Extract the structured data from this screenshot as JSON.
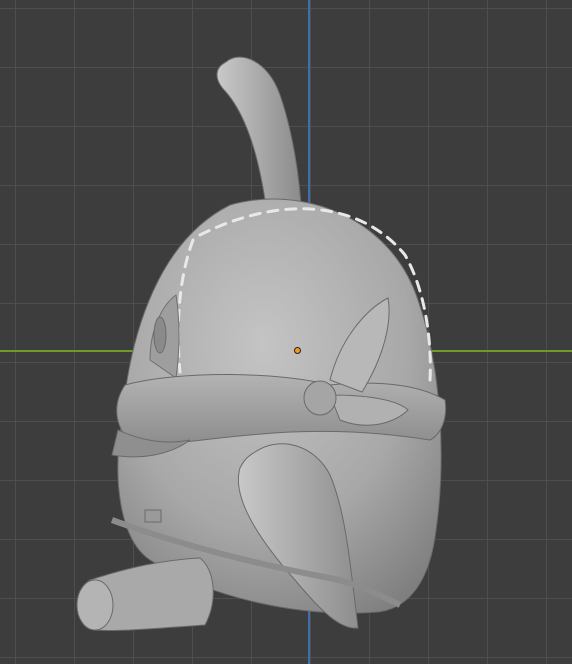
{
  "viewport": {
    "grid_color": "#505050",
    "background_color": "#3d3d3d",
    "x_axis_color": "#6f9a2a",
    "y_axis_color": "#3f6fad",
    "origin_marker_color": "#f39a1d"
  },
  "model": {
    "material_color": "#a7a7a7"
  }
}
